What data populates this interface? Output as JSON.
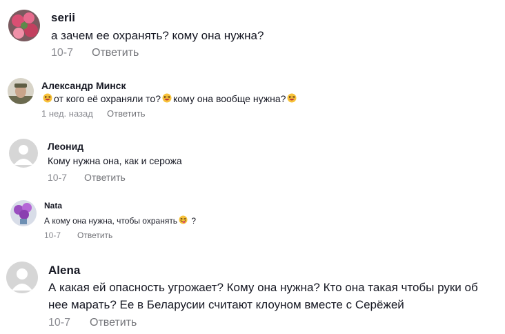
{
  "comments": [
    {
      "name": "serii",
      "text": "а зачем ее охранять? кому она нужна?",
      "date": "10-7",
      "reply": "Ответить",
      "avatar": "flowers-avatar"
    },
    {
      "name": "Александр Минск",
      "text_parts": [
        "от кого её охраняли то?",
        "кому она вообще нужна?"
      ],
      "date": "1 нед. назад",
      "reply": "Ответить",
      "avatar": "soldier-avatar",
      "emoji": "grinning-squinting-face-icon"
    },
    {
      "name": "Леонид",
      "text": "Кому нужна она, как и серожа",
      "date": "10-7",
      "reply": "Ответить",
      "avatar": "default-avatar"
    },
    {
      "name": "Nata",
      "text_parts": [
        "А кому она нужна, чтобы охранять",
        "?"
      ],
      "date": "10-7",
      "reply": "Ответить",
      "avatar": "lilac-avatar",
      "emoji": "tongue-wink-face-icon"
    },
    {
      "name": "Alena",
      "text_lines": [
        "А какая ей опасность угрожает? Кому она нужна? Кто она такая чтобы руки об",
        "нее марать? Ее в Беларусии считают клоуном вместе с Серёжей"
      ],
      "date": "10-7",
      "reply": "Ответить",
      "avatar": "default-avatar"
    }
  ]
}
